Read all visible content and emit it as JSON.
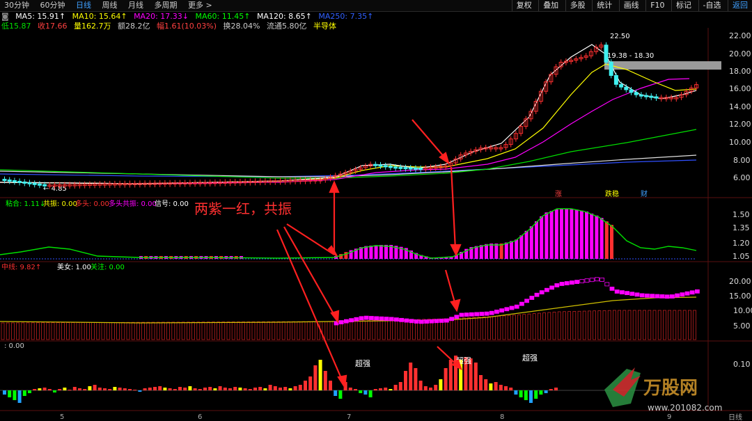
{
  "toolbar": {
    "tabs": [
      "30分钟",
      "60分钟",
      "日线",
      "周线",
      "月线",
      "多周期",
      "更多 >"
    ],
    "active_tab": 2,
    "right_buttons": [
      "复权",
      "叠加",
      "多股",
      "统计",
      "画线",
      "F10",
      "标记",
      "-自选",
      "返回"
    ]
  },
  "ma_row": {
    "items": [
      {
        "label": "MA5: 15.91↑",
        "color": "#ffffff"
      },
      {
        "label": "MA10: 15.64↑",
        "color": "#ffff00"
      },
      {
        "label": "MA20: 17.33↓",
        "color": "#ff00ff"
      },
      {
        "label": "MA60: 11.45↑",
        "color": "#00ff00"
      },
      {
        "label": "MA120: 8.65↑",
        "color": "#ffffff"
      },
      {
        "label": "MA250: 7.35↑",
        "color": "#3060ff"
      }
    ]
  },
  "quote_row": {
    "items": [
      {
        "label": "低15.87",
        "color": "#00e000"
      },
      {
        "label": "收17.66",
        "color": "#ff4040"
      },
      {
        "label": "量162.7万",
        "color": "#ffff00"
      },
      {
        "label": "额28.2亿",
        "color": "#cccccc"
      },
      {
        "label": "幅1.61(10.03%)",
        "color": "#ff4040"
      },
      {
        "label": "换28.04%",
        "color": "#cccccc"
      },
      {
        "label": "流通5.80亿",
        "color": "#cccccc"
      },
      {
        "label": "半导体",
        "color": "#ffff00"
      }
    ]
  },
  "price_axis": [
    "22.00",
    "20.00",
    "18.00",
    "16.00",
    "14.00",
    "12.00",
    "10.00",
    "8.00",
    "6.00"
  ],
  "price_notes": {
    "high": "22.50",
    "range": "19.38 - 18.30",
    "low": "4.85"
  },
  "price_tags": [
    {
      "text": "涨",
      "color": "#ff4040"
    },
    {
      "text": "跌稳",
      "color": "#ffff00"
    },
    {
      "text": "财",
      "color": "#40a0ff"
    }
  ],
  "ind1": {
    "labels": [
      {
        "text": "粘合: 1.11↓",
        "color": "#00ff00"
      },
      {
        "text": "共振: 0.00",
        "color": "#ffff00"
      },
      {
        "text": "多头: 0.00",
        "color": "#ff3030"
      },
      {
        "text": "多头共振: 0.00",
        "color": "#ff00ff"
      },
      {
        "text": "信号: 0.00",
        "color": "#ffffff"
      }
    ],
    "axis": [
      "1.50",
      "1.35",
      "1.20",
      "1.05"
    ]
  },
  "ind2": {
    "labels": [
      {
        "text": "中线: 9.82↑",
        "color": "#ff3030"
      },
      {
        "text": "美女: 1.00",
        "color": "#ffffff"
      },
      {
        "text": "关注: 0.00",
        "color": "#00ff00"
      }
    ],
    "axis": [
      "20.00",
      "15.00",
      "10.00",
      "5.00"
    ]
  },
  "ind3": {
    "labels": [
      {
        "text": ": 0.00",
        "color": "#cccccc"
      }
    ],
    "axis": [
      "0.10"
    ],
    "marks": [
      "超强",
      "超强",
      "超强"
    ]
  },
  "dates": [
    "5",
    "6",
    "7",
    "8",
    "9"
  ],
  "annotation": "两紫一红，共振",
  "watermark": {
    "brand": "万股网",
    "url": "www.201082.com"
  },
  "bottom_right": "日线",
  "colors": {
    "up": "#ff3030",
    "down": "#40f0f0",
    "magenta": "#ff00ff",
    "yellow": "#ffff00",
    "green": "#00ff00",
    "blue": "#3050ff"
  }
}
